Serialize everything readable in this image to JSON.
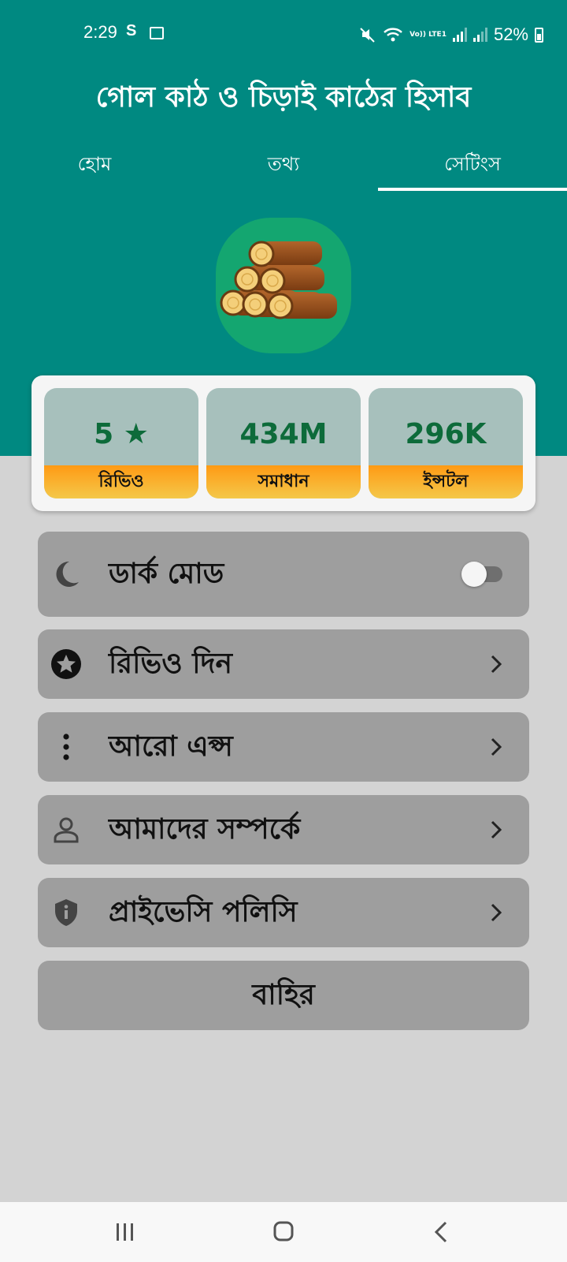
{
  "status_bar": {
    "time": "2:29",
    "s_indicator": "S",
    "volte": "Vo)) LTE1",
    "battery": "52%"
  },
  "app_title": "গোল কাঠ ও চিড়াই কাঠের হিসাব",
  "tabs": [
    {
      "label": "হোম",
      "active": false
    },
    {
      "label": "তথ্য",
      "active": false
    },
    {
      "label": "সেটিংস",
      "active": true
    }
  ],
  "stats": [
    {
      "value": "5 ★",
      "label": "রিভিও"
    },
    {
      "value": "434M",
      "label": "সমাধান"
    },
    {
      "value": "296K",
      "label": "ইন্সটল"
    }
  ],
  "menu": {
    "dark_mode": {
      "label": "ডার্ক মোড",
      "icon": "moon-icon",
      "enabled": false
    },
    "review": {
      "label": "রিভিও দিন",
      "icon": "star-circle-icon"
    },
    "more_apps": {
      "label": "আরো এপ্স",
      "icon": "more-vertical-icon"
    },
    "about": {
      "label": "আমাদের সম্পর্কে",
      "icon": "person-icon"
    },
    "privacy": {
      "label": "প্রাইভেসি পলিসি",
      "icon": "shield-info-icon"
    },
    "exit": {
      "label": "বাহির"
    }
  },
  "colors": {
    "primary": "#008981",
    "stat_value": "#0d6b3a",
    "accent_orange": "#ff9a14",
    "menu_bg": "#9e9e9e",
    "page_bg": "#d3d3d3"
  }
}
